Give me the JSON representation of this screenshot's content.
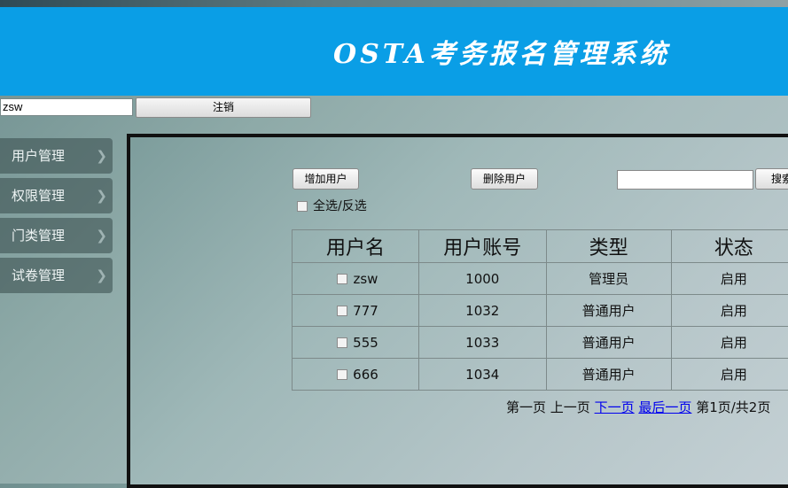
{
  "header": {
    "title": "OSTA考务报名管理系统"
  },
  "userbar": {
    "username_value": "zsw",
    "logout_label": "注销"
  },
  "sidebar": {
    "items": [
      {
        "label": "用户管理"
      },
      {
        "label": "权限管理"
      },
      {
        "label": "门类管理"
      },
      {
        "label": "试卷管理"
      }
    ]
  },
  "toolbar": {
    "add_label": "增加用户",
    "delete_label": "删除用户",
    "search_label": "搜索",
    "search_value": ""
  },
  "select_all_label": "全选/反选",
  "table": {
    "headers": [
      "用户名",
      "用户账号",
      "类型",
      "状态"
    ],
    "rows": [
      {
        "name": "zsw",
        "account": "1000",
        "type": "管理员",
        "status": "启用"
      },
      {
        "name": "777",
        "account": "1032",
        "type": "普通用户",
        "status": "启用"
      },
      {
        "name": "555",
        "account": "1033",
        "type": "普通用户",
        "status": "启用"
      },
      {
        "name": "666",
        "account": "1034",
        "type": "普通用户",
        "status": "启用"
      }
    ]
  },
  "pager": {
    "first": "第一页",
    "prev": "上一页",
    "next": "下一页",
    "last": "最后一页",
    "info": "第1页/共2页"
  },
  "colors": {
    "header_bg": "#0a9ee6",
    "link": "#0000ee"
  }
}
